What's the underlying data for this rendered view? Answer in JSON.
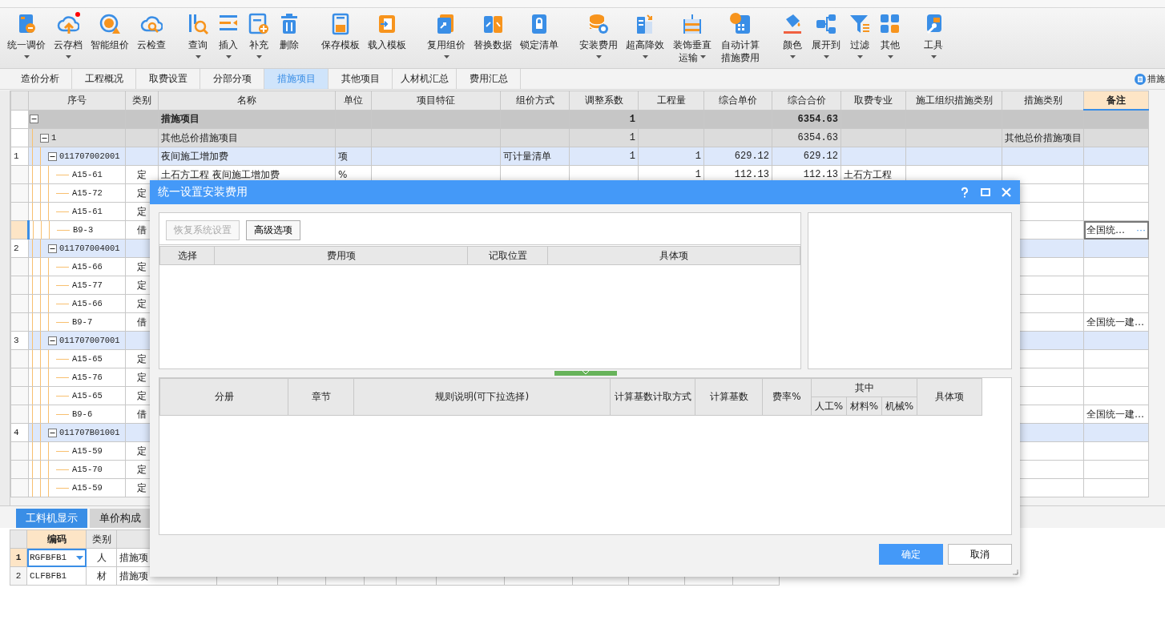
{
  "toolbar": {
    "groups": [
      [
        {
          "label": "统一调价",
          "dropdown": true,
          "notification": false
        },
        {
          "label": "云存档",
          "dropdown": true,
          "notification": true
        },
        {
          "label": "智能组价",
          "dropdown": false,
          "notification": false
        },
        {
          "label": "云检查",
          "dropdown": false,
          "notification": false
        }
      ],
      [
        {
          "label": "查询",
          "dropdown": true,
          "notification": false
        },
        {
          "label": "插入",
          "dropdown": true,
          "notification": false
        },
        {
          "label": "补充",
          "dropdown": true,
          "notification": false
        },
        {
          "label": "删除",
          "dropdown": false,
          "notification": false
        }
      ],
      [
        {
          "label": "保存模板",
          "dropdown": false,
          "notification": false
        },
        {
          "label": "载入模板",
          "dropdown": false,
          "notification": false
        }
      ],
      [
        {
          "label": "复用组价",
          "dropdown": true,
          "notification": false
        },
        {
          "label": "替换数据",
          "dropdown": false,
          "notification": false
        },
        {
          "label": "锁定清单",
          "dropdown": false,
          "notification": false
        }
      ],
      [
        {
          "label": "安装费用",
          "dropdown": true,
          "notification": false
        },
        {
          "label": "超高降效",
          "dropdown": true,
          "notification": false
        },
        {
          "label": "装饰垂直运输",
          "dropdown": true,
          "notification": false
        },
        {
          "label": "自动计算措施费用",
          "dropdown": false,
          "notification": false
        }
      ],
      [
        {
          "label": "颜色",
          "dropdown": true,
          "notification": false
        },
        {
          "label": "展开到",
          "dropdown": true,
          "notification": false
        },
        {
          "label": "过滤",
          "dropdown": true,
          "notification": false
        },
        {
          "label": "其他",
          "dropdown": true,
          "notification": false
        }
      ],
      [
        {
          "label": "工具",
          "dropdown": true,
          "notification": false
        }
      ]
    ]
  },
  "tabs": [
    {
      "label": "造价分析",
      "selected": false
    },
    {
      "label": "工程概况",
      "selected": false
    },
    {
      "label": "取费设置",
      "selected": false
    },
    {
      "label": "分部分项",
      "selected": false
    },
    {
      "label": "措施项目",
      "selected": true
    },
    {
      "label": "其他项目",
      "selected": false
    },
    {
      "label": "人材机汇总",
      "selected": false
    },
    {
      "label": "费用汇总",
      "selected": false
    }
  ],
  "side_panel_tab": {
    "label": "措施"
  },
  "table": {
    "columns": [
      {
        "label": "序号",
        "selected": false
      },
      {
        "label": "类别",
        "selected": false
      },
      {
        "label": "名称",
        "selected": false
      },
      {
        "label": "单位",
        "selected": false
      },
      {
        "label": "项目特征",
        "selected": false
      },
      {
        "label": "组价方式",
        "selected": false
      },
      {
        "label": "调整系数",
        "selected": false
      },
      {
        "label": "工程量",
        "selected": false
      },
      {
        "label": "综合单价",
        "selected": false
      },
      {
        "label": "综合合价",
        "selected": false
      },
      {
        "label": "取费专业",
        "selected": false
      },
      {
        "label": "施工组织措施类别",
        "selected": false
      },
      {
        "label": "措施类别",
        "selected": false
      },
      {
        "label": "备注",
        "selected": true
      }
    ],
    "rows": [
      {
        "kind": "group",
        "selected": false,
        "expanded": true,
        "name": "措施项目",
        "adjust_factor": "1",
        "total_price": "6354.63",
        "children": [
          {
            "kind": "subgroup",
            "selected": false,
            "expanded": true,
            "code": "1",
            "name": "其他总价措施项目",
            "adjust_factor": "1",
            "total_price": "6354.63",
            "measure_type": "其他总价措施项目",
            "children": [
              {
                "kind": "item",
                "selected": false,
                "expanded": true,
                "number": "1",
                "code": "011707002001",
                "name": "夜间施工增加费",
                "unit": "项",
                "pricing_method": "可计量清单",
                "adjust_factor": "1",
                "quantity": "1",
                "unit_price": "629.12",
                "total_price": "629.12",
                "children": [
                  {
                    "kind": "sub",
                    "selected": false,
                    "code": "A15-61",
                    "category": "定",
                    "name": "土石方工程 夜间施工增加费",
                    "unit": "%",
                    "quantity": "1",
                    "unit_price": "112.13",
                    "total_price": "112.13",
                    "fee_specialty": "土石方工程"
                  },
                  {
                    "kind": "sub",
                    "selected": false,
                    "code": "A15-72",
                    "category": "定"
                  },
                  {
                    "kind": "sub",
                    "selected": false,
                    "code": "A15-61",
                    "category": "定"
                  },
                  {
                    "kind": "sub",
                    "selected": true,
                    "code": "B9-3",
                    "category": "借",
                    "remark": "全国统…",
                    "remark_action": "···"
                  }
                ]
              },
              {
                "kind": "item",
                "selected": false,
                "expanded": true,
                "number": "2",
                "code": "011707004001",
                "children": [
                  {
                    "kind": "sub",
                    "selected": false,
                    "code": "A15-66",
                    "category": "定"
                  },
                  {
                    "kind": "sub",
                    "selected": false,
                    "code": "A15-77",
                    "category": "定"
                  },
                  {
                    "kind": "sub",
                    "selected": false,
                    "code": "A15-66",
                    "category": "定"
                  },
                  {
                    "kind": "sub",
                    "selected": false,
                    "code": "B9-7",
                    "category": "借",
                    "remark": "全国统一建…"
                  }
                ]
              },
              {
                "kind": "item",
                "selected": false,
                "expanded": true,
                "number": "3",
                "code": "011707007001",
                "children": [
                  {
                    "kind": "sub",
                    "selected": false,
                    "code": "A15-65",
                    "category": "定"
                  },
                  {
                    "kind": "sub",
                    "selected": false,
                    "code": "A15-76",
                    "category": "定"
                  },
                  {
                    "kind": "sub",
                    "selected": false,
                    "code": "A15-65",
                    "category": "定"
                  },
                  {
                    "kind": "sub",
                    "selected": false,
                    "code": "B9-6",
                    "category": "借",
                    "remark": "全国统一建…"
                  }
                ]
              },
              {
                "kind": "item",
                "selected": false,
                "expanded": true,
                "number": "4",
                "code": "011707B01001",
                "children": [
                  {
                    "kind": "sub",
                    "selected": false,
                    "code": "A15-59",
                    "category": "定"
                  },
                  {
                    "kind": "sub",
                    "selected": false,
                    "code": "A15-70",
                    "category": "定"
                  },
                  {
                    "kind": "sub",
                    "selected": false,
                    "code": "A15-59",
                    "category": "定"
                  }
                ]
              }
            ]
          }
        ]
      }
    ]
  },
  "bottom_panel": {
    "tabs": [
      {
        "label": "工料机显示",
        "selected": true
      },
      {
        "label": "单价构成",
        "selected": false
      }
    ],
    "columns": [
      {
        "label": "编码",
        "selected": true
      },
      {
        "label": "类别",
        "selected": false
      }
    ],
    "rows": [
      {
        "number": "1",
        "code": "RGFBFB1",
        "category": "人",
        "name": "措施项",
        "selected": true
      },
      {
        "number": "2",
        "code": "CLFBFB1",
        "category": "材",
        "name": "措施项",
        "selected": false
      }
    ]
  },
  "dialog": {
    "title": "统一设置安装费用",
    "buttons": [
      {
        "label": "恢复系统设置",
        "disabled": true
      },
      {
        "label": "高级选项",
        "disabled": false
      }
    ],
    "fee_columns": [
      "选择",
      "费用项",
      "记取位置",
      "具体项"
    ],
    "rule_columns": [
      {
        "label": "分册"
      },
      {
        "label": "章节"
      },
      {
        "label": "规则说明(可下拉选择)"
      },
      {
        "label": "计算基数计取方式"
      },
      {
        "label": "计算基数"
      },
      {
        "label": "费率%"
      },
      {
        "label": "其中",
        "children": [
          "人工%",
          "材料%",
          "机械%"
        ]
      },
      {
        "label": "具体项"
      }
    ],
    "confirm": "确定",
    "cancel": "取消"
  }
}
